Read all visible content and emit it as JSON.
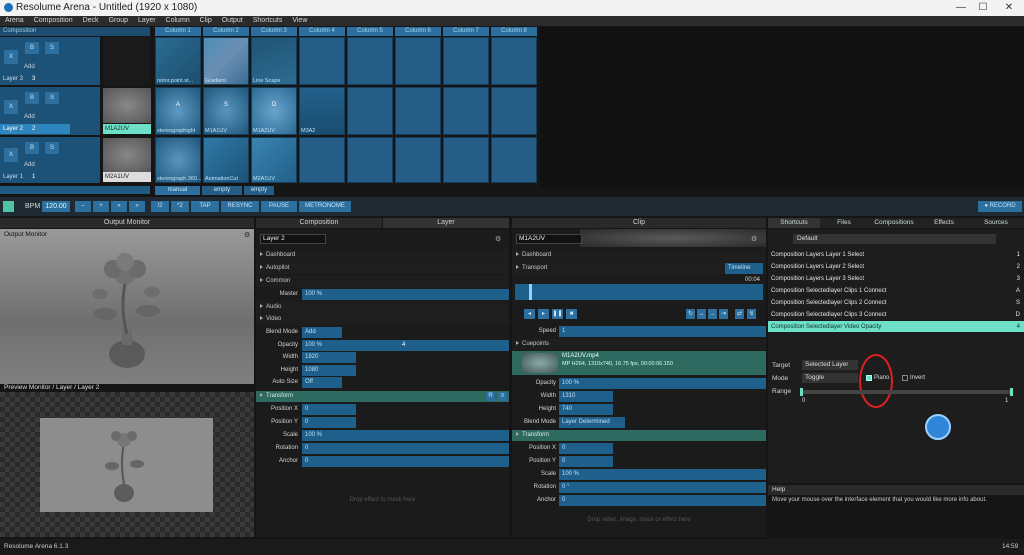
{
  "window": {
    "title": "Resolume Arena - Untitled (1920 x 1080)",
    "min": "—",
    "max": "☐",
    "close": "✕"
  },
  "menu": [
    "Arena",
    "Composition",
    "Deck",
    "Group",
    "Layer",
    "Column",
    "Clip",
    "Output",
    "Shortcuts",
    "View"
  ],
  "composition": {
    "label": "Composition",
    "x": "X",
    "b": "B",
    "s": "S"
  },
  "columns": [
    "Column 1",
    "Column 2",
    "Column 3",
    "Column 4",
    "Column 5",
    "Column 6",
    "Column 7",
    "Column 8"
  ],
  "layers": [
    {
      "name": "Layer 3",
      "num": "3",
      "add": "Add",
      "thumb": "",
      "clips": [
        "notor.point.st...",
        "Gradient",
        "Line Scape"
      ],
      "letters": [
        "",
        "",
        ""
      ]
    },
    {
      "name": "Layer 2",
      "num": "2",
      "add": "Add",
      "thumb": "M1A2UV",
      "clips": [
        "stereographight",
        "M1A1UV",
        "M1A2UV",
        "M3A2"
      ],
      "letters": [
        "A",
        "S",
        "D",
        ""
      ]
    },
    {
      "name": "Layer 1",
      "num": "1",
      "add": "Add",
      "thumb": "M2A1UV",
      "clips": [
        "stereograph.360...",
        "AnimationCut",
        "M2A1UV"
      ],
      "letters": [
        "",
        "",
        ""
      ]
    }
  ],
  "decks": [
    "manual",
    "empty",
    "empty"
  ],
  "transport": {
    "bpm_label": "BPM",
    "bpm": "120.00",
    "halve": "/2",
    "double": "*2",
    "tap": "TAP",
    "resync": "RESYNC",
    "pause": "PAUSE",
    "metronome": "METRONOME",
    "record": "RECORD",
    "minus": "–",
    "plus": "+",
    "m2": "«",
    "p2": "»"
  },
  "output": {
    "title": "Output Monitor",
    "label": "Output Monitor",
    "preview_label": "Preview Monitor / Layer / Layer 2"
  },
  "layerpanel": {
    "tab_comp": "Composition",
    "tab_layer": "Layer",
    "name": "Layer 2",
    "sections": {
      "dashboard": "Dashboard",
      "autopilot": "Autopilot",
      "common": "Common",
      "audio": "Audio",
      "video": "Video",
      "transform": "Transform"
    },
    "master": {
      "label": "Master",
      "value": "100 %"
    },
    "blend": {
      "label": "Blend Mode",
      "value": "Add"
    },
    "opacity": {
      "label": "Opacity",
      "value": "100 %",
      "center": "4"
    },
    "width": {
      "label": "Width",
      "value": "1920"
    },
    "height": {
      "label": "Height",
      "value": "1080"
    },
    "autosize": {
      "label": "Auto Size",
      "value": "Off"
    },
    "posx": {
      "label": "Position X",
      "value": "0"
    },
    "posy": {
      "label": "Position Y",
      "value": "0"
    },
    "scale": {
      "label": "Scale",
      "value": "100 %"
    },
    "rotation": {
      "label": "Rotation",
      "value": "0"
    },
    "anchor": {
      "label": "Anchor",
      "value": "0"
    },
    "drop": "Drop effect to mask here"
  },
  "clippanel": {
    "title": "Clip",
    "name": "M1A2UV",
    "sections": {
      "dashboard": "Dashboard",
      "transport": "Transport",
      "cuepoints": "Cuepoints",
      "transform": "Transform"
    },
    "timeline": "Timeline",
    "time": "00:04",
    "speed": {
      "label": "Speed",
      "value": "1"
    },
    "file": {
      "name": "M1A2UV.mp4",
      "info": "MP H264, 1310x740, 16.75 fps, 00:00:06.150"
    },
    "opacity": {
      "label": "Opacity",
      "value": "100 %"
    },
    "width": {
      "label": "Width",
      "value": "1310"
    },
    "height": {
      "label": "Height",
      "value": "740"
    },
    "blend": {
      "label": "Blend Mode",
      "value": "Layer Determined"
    },
    "posx": {
      "label": "Position X",
      "value": "0"
    },
    "posy": {
      "label": "Position Y",
      "value": "0"
    },
    "scale": {
      "label": "Scale",
      "value": "100 %"
    },
    "rotation": {
      "label": "Rotation",
      "value": "0 °"
    },
    "anchor": {
      "label": "Anchor",
      "value": "0"
    },
    "drop": "Drop video, image, mask or effect here"
  },
  "shortcuts": {
    "tabs": [
      "Shortcuts",
      "Files",
      "Compositions",
      "Effects",
      "Sources"
    ],
    "preset": "Default",
    "rows": [
      {
        "name": "Composition Layers Layer 1 Select",
        "key": "1"
      },
      {
        "name": "Composition Layers Layer 2 Select",
        "key": "2"
      },
      {
        "name": "Composition Layers Layer 3 Select",
        "key": "3"
      },
      {
        "name": "Composition Selectedlayer Clips 1 Connect",
        "key": "A"
      },
      {
        "name": "Composition Selectedlayer Clips 2 Connect",
        "key": "S"
      },
      {
        "name": "Composition Selectedlayer Clips 3 Connect",
        "key": "D"
      },
      {
        "name": "Composition Selectedlayer Video Opacity",
        "key": "4"
      }
    ],
    "target": {
      "label": "Target",
      "value": "Selected Layer"
    },
    "mode": {
      "label": "Mode",
      "value": "Toggle",
      "piano": "Piano",
      "invert": "Invert"
    },
    "range": {
      "label": "Range",
      "min": "0",
      "max": "1"
    }
  },
  "help": {
    "title": "Help",
    "text": "Move your mouse over the interface element that you would like more info about."
  },
  "status": {
    "version": "Resolume Arena 6.1.3",
    "time": "14:59"
  },
  "colors": {
    "accent": "#2c6f9f",
    "highlight": "#6fe0c8",
    "annotation": "#e02020"
  }
}
